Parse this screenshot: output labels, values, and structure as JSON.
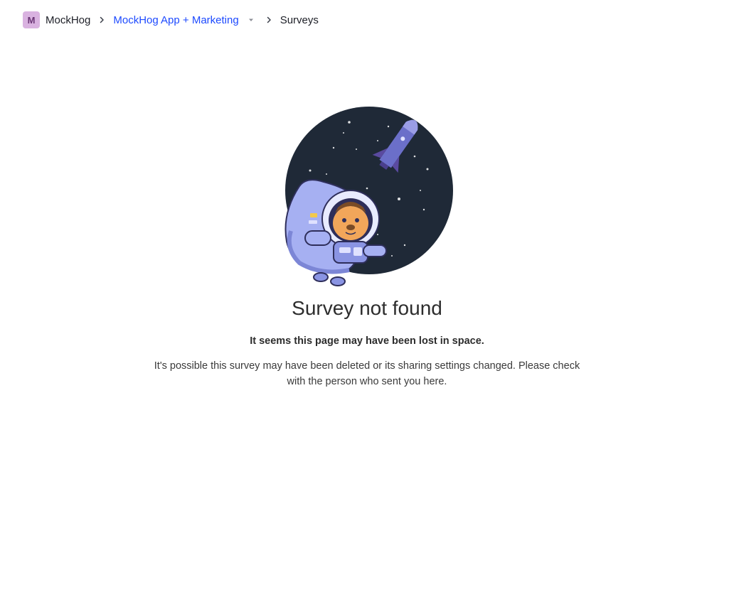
{
  "breadcrumb": {
    "org_initial": "M",
    "org_name": "MockHog",
    "project_name": "MockHog App + Marketing",
    "current_page": "Surveys"
  },
  "icons": {
    "separator": "chevron-right-icon",
    "project_dropdown": "caret-down-icon",
    "illustration": "astronaut-hedgehog-space-illustration"
  },
  "colors": {
    "link": "#1d4aff",
    "avatar_bg": "#d9b2e0",
    "space_bg": "#1f2937"
  },
  "error": {
    "title": "Survey not found",
    "subtitle": "It seems this page may have been lost in space.",
    "description": "It's possible this survey may have been deleted or its sharing settings changed. Please check with the person who sent you here."
  }
}
